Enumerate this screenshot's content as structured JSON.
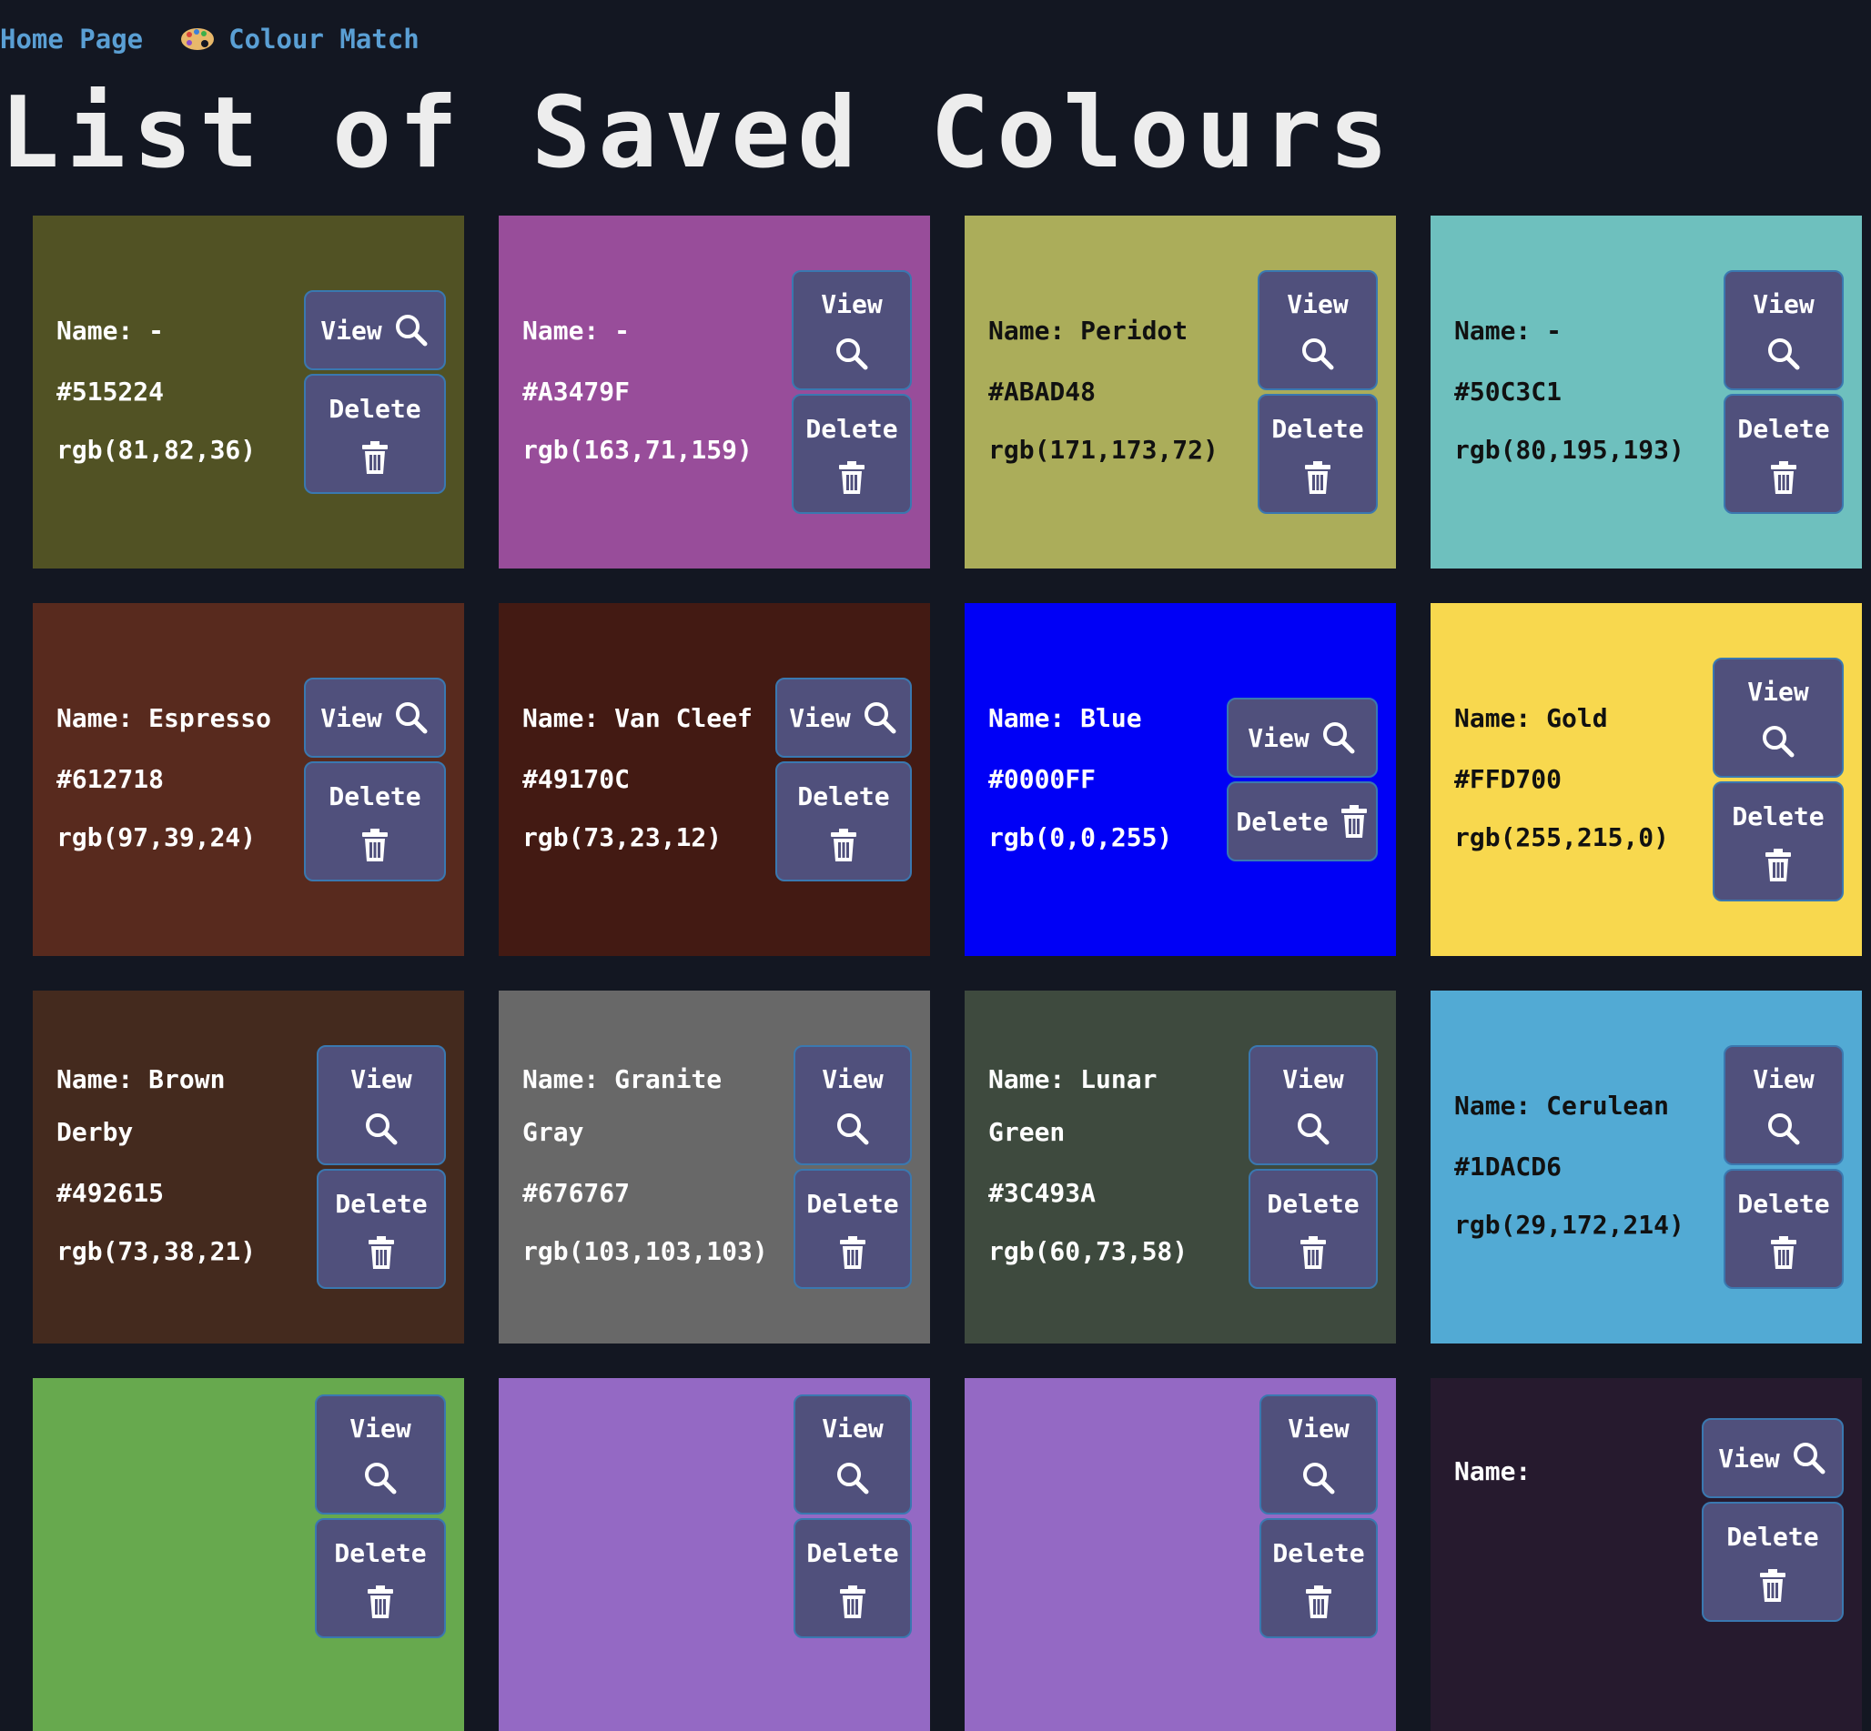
{
  "nav": {
    "home": "Home Page",
    "brand": "Colour Match"
  },
  "page_title": "List of Saved Colours",
  "buttons": {
    "view": "View",
    "delete": "Delete"
  },
  "colours": [
    {
      "name": "Name: -",
      "hex": "#515224",
      "rgb": "rgb(81,82,36)",
      "bg": "#515224",
      "text": "light"
    },
    {
      "name": "Name: -",
      "hex": "#A3479F",
      "rgb": "rgb(163,71,159)",
      "bg": "#984D9A",
      "text": "light"
    },
    {
      "name": "Name: Peridot",
      "hex": "#ABAD48",
      "rgb": "rgb(171,173,72)",
      "bg": "#ABAD5A",
      "text": "dark"
    },
    {
      "name": "Name: -",
      "hex": "#50C3C1",
      "rgb": "rgb(80,195,193)",
      "bg": "#6EC0BE",
      "text": "dark"
    },
    {
      "name": "Name: Espresso",
      "hex": "#612718",
      "rgb": "rgb(97,39,24)",
      "bg": "#582A1E",
      "text": "light"
    },
    {
      "name": "Name: Van Cleef",
      "hex": "#49170C",
      "rgb": "rgb(73,23,12)",
      "bg": "#431A13",
      "text": "light"
    },
    {
      "name": "Name: Blue",
      "hex": "#0000FF",
      "rgb": "rgb(0,0,255)",
      "bg": "#0000F6",
      "text": "light"
    },
    {
      "name": "Name: Gold",
      "hex": "#FFD700",
      "rgb": "rgb(255,215,0)",
      "bg": "#F8D84E",
      "text": "dark"
    },
    {
      "name": "Name: Brown Derby",
      "hex": "#492615",
      "rgb": "rgb(73,38,21)",
      "bg": "#442A1E",
      "text": "light"
    },
    {
      "name": "Name: Granite Gray",
      "hex": "#676767",
      "rgb": "rgb(103,103,103)",
      "bg": "#686868",
      "text": "light"
    },
    {
      "name": "Name: Lunar Green",
      "hex": "#3C493A",
      "rgb": "rgb(60,73,58)",
      "bg": "#3E4A3E",
      "text": "light"
    },
    {
      "name": "Name: Cerulean",
      "hex": "#1DACD6",
      "rgb": "rgb(29,172,214)",
      "bg": "#52AAD4",
      "text": "dark"
    },
    {
      "name": "",
      "hex": "",
      "rgb": "",
      "bg": "#67A94E",
      "text": "dark"
    },
    {
      "name": "",
      "hex": "",
      "rgb": "",
      "bg": "#9469C4",
      "text": "light"
    },
    {
      "name": "",
      "hex": "",
      "rgb": "",
      "bg": "#9469C4",
      "text": "light"
    },
    {
      "name": "Name:",
      "hex": "",
      "rgb": "",
      "bg": "#261A2E",
      "text": "light"
    }
  ]
}
